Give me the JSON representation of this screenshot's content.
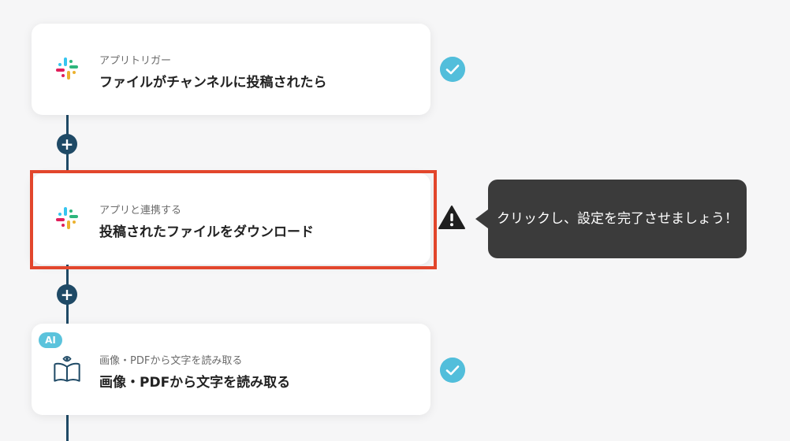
{
  "steps": [
    {
      "subtitle": "アプリトリガー",
      "title": "ファイルがチャンネルに投稿されたら",
      "icon": "slack-icon",
      "status": "complete"
    },
    {
      "subtitle": "アプリと連携する",
      "title": "投稿されたファイルをダウンロード",
      "icon": "slack-icon",
      "status": "warning"
    },
    {
      "badge": "AI",
      "subtitle": "画像・PDFから文字を読み取る",
      "title": "画像・PDFから文字を読み取る",
      "icon": "book-eye-icon",
      "status": "complete"
    }
  ],
  "tooltip": {
    "text": "クリックし、設定を完了させましょう！"
  },
  "add_step_symbol": "+",
  "colors": {
    "connector": "#1f4a66",
    "check": "#4dbbd2",
    "highlight": "#e2462c",
    "tooltip_bg": "#3b3b3b",
    "ai_badge": "#5bc3dc"
  }
}
